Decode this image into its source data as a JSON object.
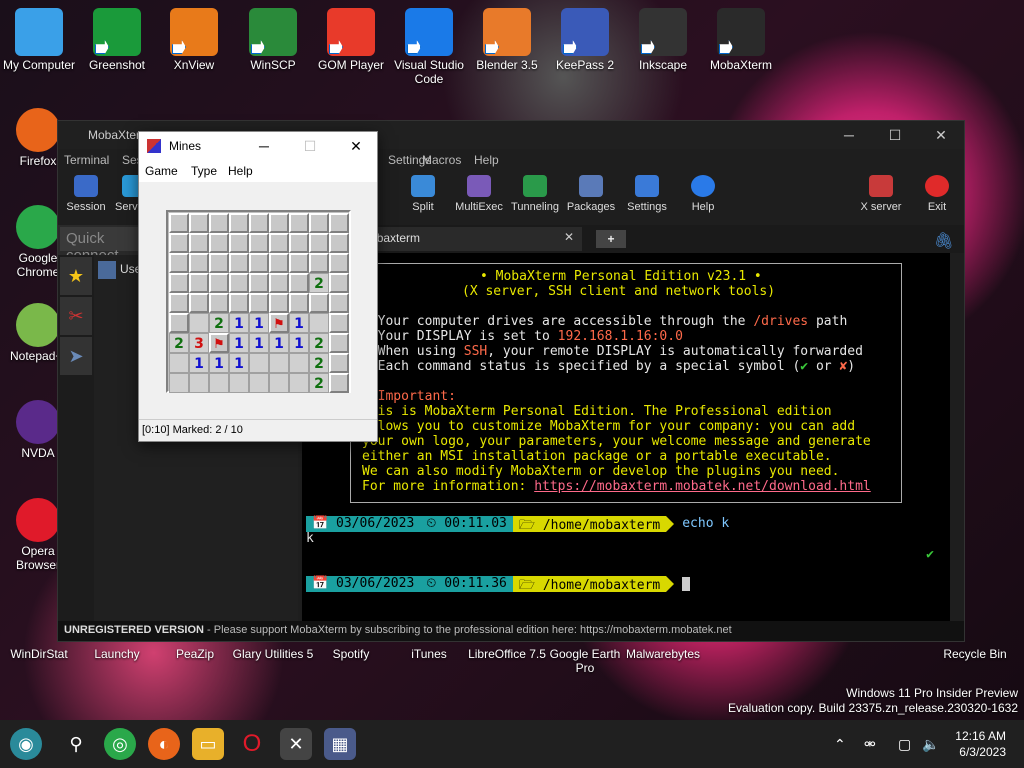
{
  "desktop": {
    "top_icons": [
      {
        "label": "My Computer",
        "color": "#3aa0e8"
      },
      {
        "label": "Greenshot",
        "color": "#1a9a3a"
      },
      {
        "label": "XnView",
        "color": "#e87a1a"
      },
      {
        "label": "WinSCP",
        "color": "#2a8a3a"
      },
      {
        "label": "GOM Player",
        "color": "#e83a2a"
      },
      {
        "label": "Visual Studio Code",
        "color": "#1a7ae8"
      },
      {
        "label": "Blender 3.5",
        "color": "#e87a2a"
      },
      {
        "label": "KeePass 2",
        "color": "#3a5ab8"
      },
      {
        "label": "Inkscape",
        "color": "#333333"
      },
      {
        "label": "MobaXterm",
        "color": "#2a2a2a"
      }
    ],
    "left_icons": [
      {
        "label": "Firefox",
        "color": "#e8641a"
      },
      {
        "label": "Google Chrome",
        "color": "#2aa84a"
      },
      {
        "label": "Notepad++",
        "color": "#7ab84a"
      },
      {
        "label": "NVDA",
        "color": "#5a2a8a"
      },
      {
        "label": "Opera Browser",
        "color": "#e01a2a"
      },
      {
        "label": "WinDirStat",
        "color": "#3a7a2a"
      }
    ],
    "bottom_icons": [
      "WinDirStat",
      "Launchy",
      "PeaZip",
      "Glary Utilities 5",
      "Spotify",
      "iTunes",
      "LibreOffice 7.5",
      "Google Earth Pro",
      "Malwarebytes",
      "Recycle Bin"
    ],
    "watermark_line1": "Windows 11 Pro Insider Preview",
    "watermark_line2": "Evaluation copy. Build 23375.zn_release.230320-1632"
  },
  "moba": {
    "title": "MobaXterm",
    "menu": [
      "Terminal",
      "Sessions",
      "View",
      "X server",
      "Tools",
      "Games",
      "Settings",
      "Macros",
      "Help"
    ],
    "toolbar": [
      "Session",
      "Servers",
      "Split",
      "MultiExec",
      "Tunneling",
      "Packages",
      "Settings",
      "Help",
      "X server",
      "Exit"
    ],
    "quick_connect_placeholder": "Quick connect...",
    "session_item": "User sessions",
    "tab_label": "4. /home/mobaxterm",
    "terminal": {
      "banner_title": "• MobaXterm Personal Edition v23.1 •",
      "banner_sub": "(X server, SSH client and network tools)",
      "l1a": "➤ Your computer drives are accessible through the ",
      "l1b": "/drives",
      "l1c": " path",
      "l2a": "➤ Your DISPLAY is set to ",
      "l2b": "192.168.1.16:0.0",
      "l3a": "➤ When using ",
      "l3b": "SSH",
      "l3c": ", your remote DISPLAY is automatically forwarded",
      "l4a": "➤ Each command status is specified by a special symbol (",
      "l4b": "✔",
      "l4c": " or ",
      "l4d": "✘",
      "l4e": ")",
      "imp": "• Important:",
      "p1": "This is MobaXterm Personal Edition. The Professional edition",
      "p2": "allows you to customize MobaXterm for your company: you can add",
      "p3": "your own logo, your parameters, your welcome message and generate",
      "p4": "either an MSI installation package or a portable executable.",
      "p5": "We can also modify MobaXterm or develop the plugins you need.",
      "p6a": "For more information: ",
      "p6b": "https://mobaxterm.mobatek.net/download.html",
      "prompt1_date": "📅 03/06/2023",
      "prompt1_time": "⏲ 00:11.03",
      "prompt1_path": "🗁 /home/mobaxterm",
      "prompt1_cmd": "echo k",
      "output": "k",
      "check": "✔",
      "prompt2_date": "📅 03/06/2023",
      "prompt2_time": "⏲ 00:11.36",
      "prompt2_path": "🗁 /home/mobaxterm"
    },
    "status_bold": "UNREGISTERED VERSION",
    "status_text": "  -  Please support MobaXterm by subscribing to the professional edition here:  https://mobaxterm.mobatek.net"
  },
  "mines": {
    "title": "Mines",
    "menu": [
      "Game",
      "Type",
      "Help"
    ],
    "status": "[0:10] Marked: 2 / 10",
    "board": [
      [
        "c",
        "c",
        "c",
        "c",
        "c",
        "c",
        "c",
        "c",
        "c"
      ],
      [
        "c",
        "c",
        "c",
        "c",
        "c",
        "c",
        "c",
        "c",
        "c"
      ],
      [
        "c",
        "c",
        "c",
        "c",
        "c",
        "c",
        "c",
        "c",
        "c"
      ],
      [
        "c",
        "c",
        "c",
        "c",
        "c",
        "c",
        "c",
        "2",
        "c"
      ],
      [
        "c",
        "c",
        "c",
        "c",
        "c",
        "c",
        "c",
        "c",
        "c"
      ],
      [
        "c",
        "o",
        "2",
        "1",
        "1",
        "F",
        "1",
        "o",
        "c"
      ],
      [
        "2",
        "3",
        "F",
        "1",
        "1",
        "1",
        "1",
        "2",
        "c"
      ],
      [
        "o",
        "1",
        "1",
        "1",
        "o",
        "o",
        "o",
        "2",
        "c"
      ],
      [
        "o",
        "o",
        "o",
        "o",
        "o",
        "o",
        "o",
        "2",
        "c"
      ]
    ]
  },
  "taskbar": {
    "time": "12:16 AM",
    "date": "6/3/2023"
  }
}
